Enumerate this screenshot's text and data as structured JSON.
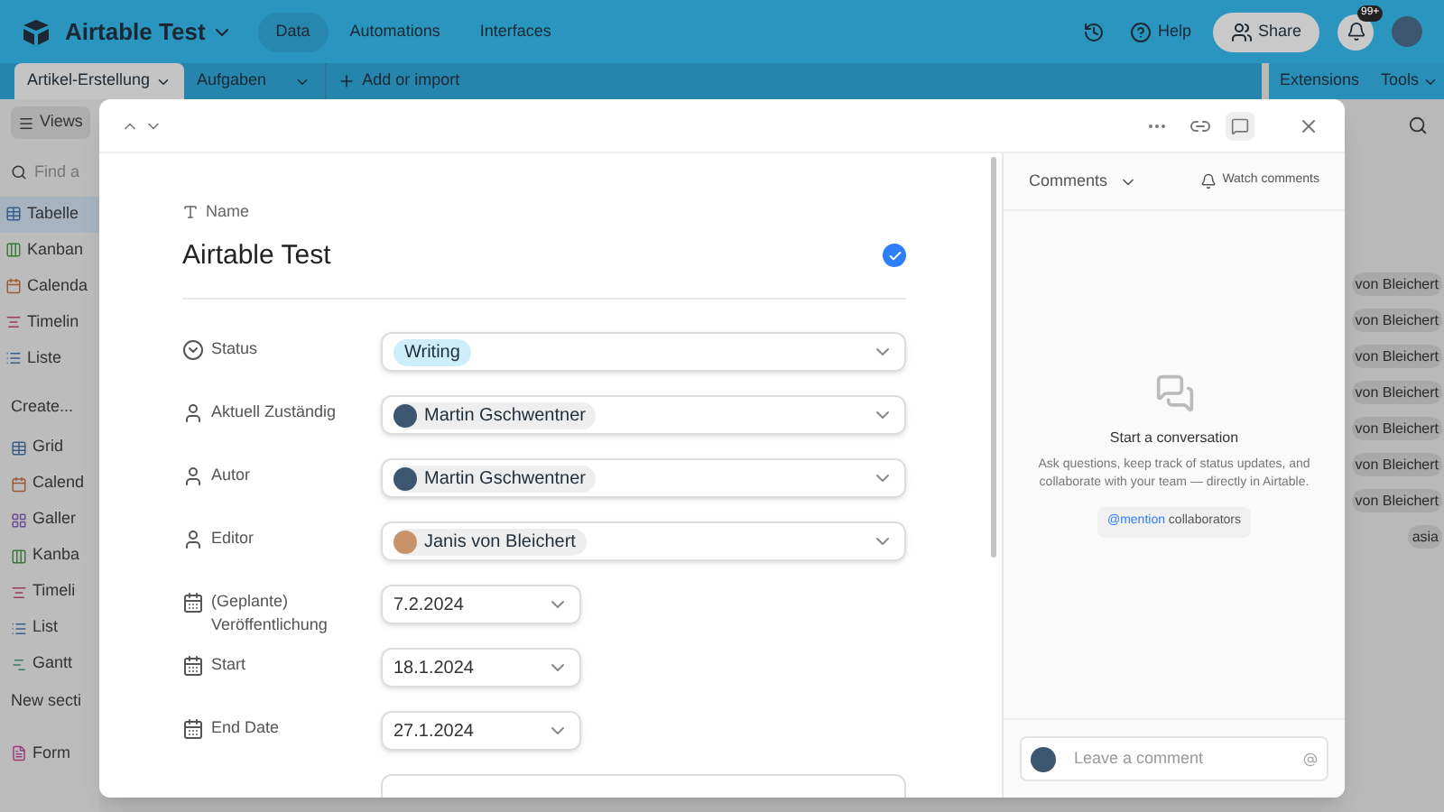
{
  "topbar": {
    "base_name": "Airtable Test",
    "nav": [
      {
        "label": "Data",
        "selected": true
      },
      {
        "label": "Automations",
        "selected": false
      },
      {
        "label": "Interfaces",
        "selected": false
      }
    ],
    "help": "Help",
    "share": "Share",
    "notification_badge": "99+"
  },
  "tabs": [
    {
      "label": "Artikel-Erstellung",
      "selected": true
    },
    {
      "label": "Aufgaben",
      "selected": false
    }
  ],
  "add_button": "Add or import",
  "extensions": "Extensions",
  "tools": "Tools",
  "views_button": "Views",
  "sidebar": {
    "search_placeholder": "Find a",
    "views": [
      {
        "label": "Tabelle",
        "kind": "grid",
        "selected": true
      },
      {
        "label": "Kanban",
        "kind": "kanban",
        "selected": false
      },
      {
        "label": "Calenda",
        "kind": "calendar",
        "selected": false
      },
      {
        "label": "Timelin",
        "kind": "timeline",
        "selected": false
      },
      {
        "label": "Liste",
        "kind": "list",
        "selected": false
      }
    ],
    "create_heading": "Create...",
    "create_items": [
      {
        "label": "Grid",
        "kind": "grid"
      },
      {
        "label": "Calend",
        "kind": "calendar"
      },
      {
        "label": "Galler",
        "kind": "gallery"
      },
      {
        "label": "Kanba",
        "kind": "kanban"
      },
      {
        "label": "Timeli",
        "kind": "timeline"
      },
      {
        "label": "List",
        "kind": "list"
      },
      {
        "label": "Gantt",
        "kind": "gantt"
      }
    ],
    "new_section": "New secti",
    "form_item": {
      "label": "Form",
      "kind": "form"
    }
  },
  "background_pills": [
    "von Bleichert",
    "von Bleichert",
    "von Bleichert",
    "von Bleichert",
    "von Bleichert",
    "von Bleichert",
    "von Bleichert",
    "asia"
  ],
  "record": {
    "name_label": "Name",
    "name": "Airtable Test",
    "fields": [
      {
        "kind": "select",
        "label": "Status",
        "value": "Writing"
      },
      {
        "kind": "user",
        "label": "Aktuell Zuständig",
        "value": "Martin Gschwentner"
      },
      {
        "kind": "user",
        "label": "Autor",
        "value": "Martin Gschwentner"
      },
      {
        "kind": "user",
        "label": "Editor",
        "value": "Janis von Bleichert"
      },
      {
        "kind": "date",
        "label": "(Geplante) Veröffentlichung",
        "value": "7.2.2024"
      },
      {
        "kind": "date",
        "label": "Start",
        "value": "18.1.2024"
      },
      {
        "kind": "date",
        "label": "End Date",
        "value": "27.1.2024"
      }
    ]
  },
  "comments": {
    "title": "Comments",
    "watch": "Watch comments",
    "empty_title": "Start a conversation",
    "empty_text": "Ask questions, keep track of status updates, and collaborate with your team — directly in Airtable.",
    "mention_hint": "**@mention** collaborators",
    "placeholder": "Leave a comment"
  }
}
